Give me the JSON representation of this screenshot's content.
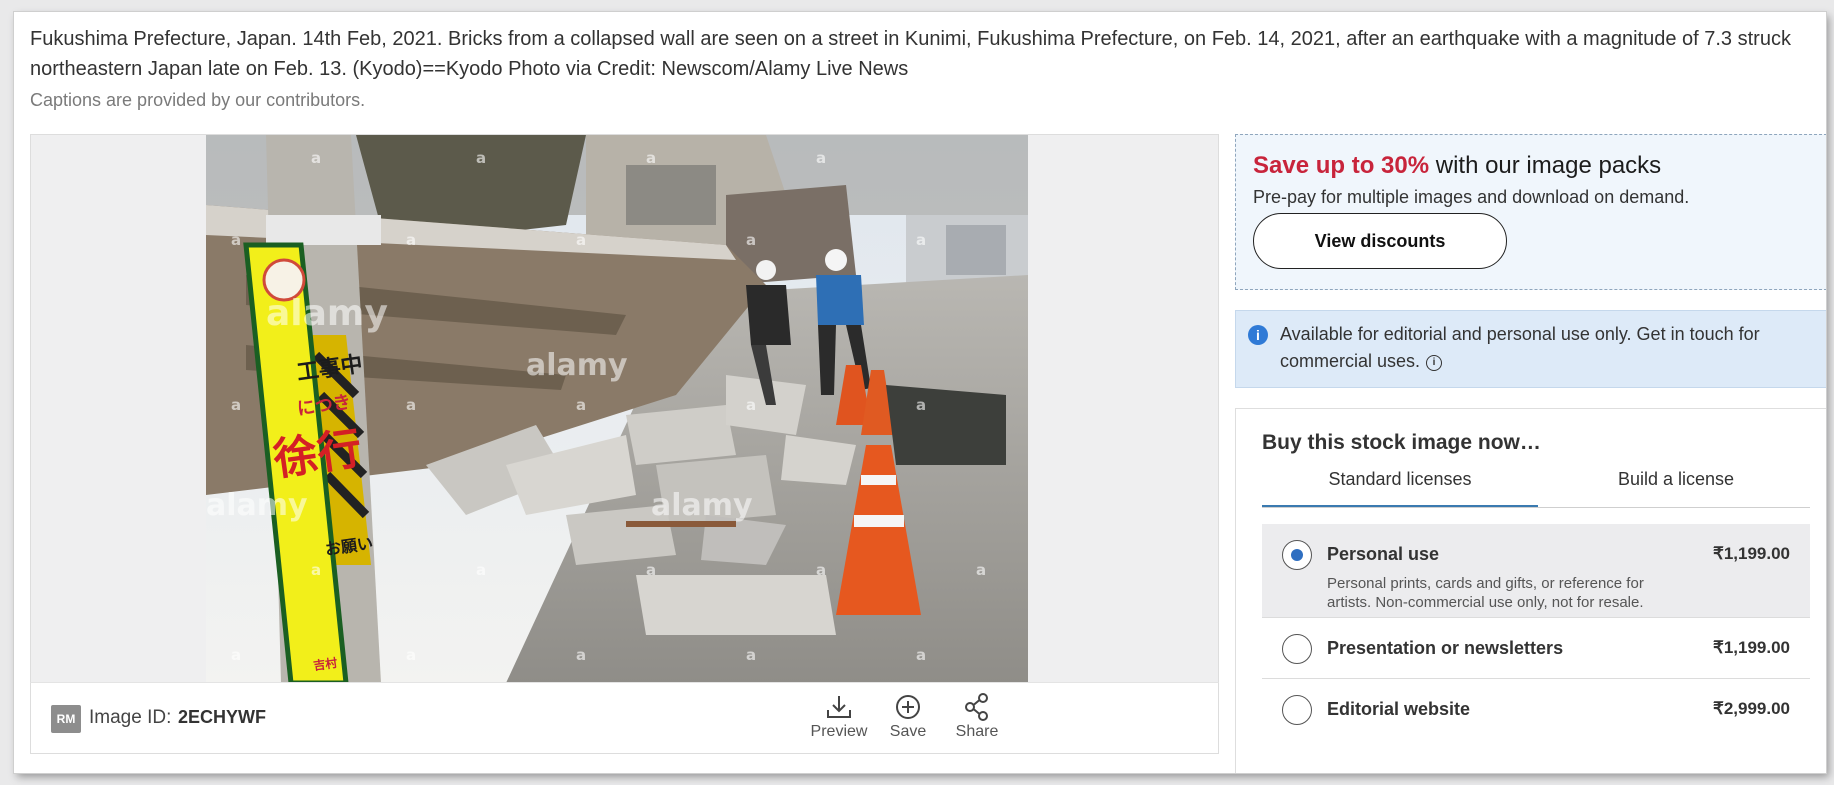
{
  "caption": {
    "text": "Fukushima Prefecture, Japan. 14th Feb, 2021. Bricks from a collapsed wall are seen on a street in Kunimi, Fukushima Prefecture, on Feb. 14, 2021, after an earthquake with a magnitude of 7.3 struck northeastern Japan late on Feb. 13. (Kyodo)==Kyodo Photo via Credit: Newscom/Alamy Live News",
    "contributors_note": "Captions are provided by our contributors."
  },
  "photo": {
    "watermark": "alamy",
    "sign_text": [
      "工事中",
      "につき",
      "徐行",
      "お願い"
    ],
    "sign_brand": "吉村"
  },
  "image_bar": {
    "badge": "RM",
    "id_label": "Image ID:",
    "id_value": "2ECHYWF",
    "actions": [
      {
        "label": "Preview",
        "icon": "download-icon"
      },
      {
        "label": "Save",
        "icon": "plus-circle-icon"
      },
      {
        "label": "Share",
        "icon": "share-icon"
      }
    ]
  },
  "promo": {
    "highlight": "Save up to 30%",
    "title_rest": " with our image packs",
    "subtitle": "Pre-pay for multiple images and download on demand.",
    "button_label": "View discounts",
    "highlight_color": "#c8243b"
  },
  "notice": {
    "text": "Available for editorial and personal use only. Get in touch for commercial uses.",
    "icon": "info-icon"
  },
  "buy": {
    "title": "Buy this stock image now…",
    "tabs": [
      "Standard licenses",
      "Build a license"
    ],
    "options": [
      {
        "name": "Personal use",
        "price": "₹1,199.00",
        "selected": true,
        "description": "Personal prints, cards and gifts, or reference for artists. Non-commercial use only, not for resale."
      },
      {
        "name": "Presentation or newsletters",
        "price": "₹1,199.00",
        "selected": false
      },
      {
        "name": "Editorial website",
        "price": "₹2,999.00",
        "selected": false
      }
    ]
  },
  "colors": {
    "accent_blue": "#2f6fc1",
    "promo_bg": "#f0f6fc",
    "notice_bg": "#ddeaf8"
  }
}
